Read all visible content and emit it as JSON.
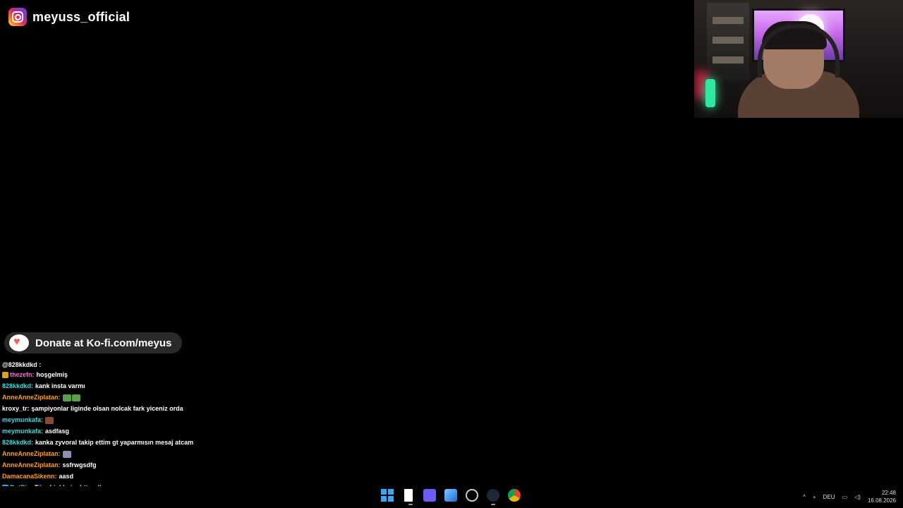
{
  "instagram": {
    "handle": "meyuss_official"
  },
  "donate": {
    "text": "Donate at Ko-fi.com/meyus"
  },
  "chat": [
    {
      "user": "@828kkdkd :",
      "text": "",
      "color": "#ffffff",
      "partial": true
    },
    {
      "user": "thezefn:",
      "text": "hoşgelmiş",
      "color": "#ff6ad5",
      "badge": "#e0a020"
    },
    {
      "user": "828kkdkd:",
      "text": "kank insta varmı",
      "color": "#3ed8e0"
    },
    {
      "user": "AnneAnneZiplatan:",
      "text": "",
      "color": "#ff9f1c",
      "emotes": [
        "#5aa04a",
        "#5aa04a"
      ]
    },
    {
      "user": "kroxy_tr:",
      "text": "şampiyonlar liginde olsan nolcak fark yiceniz orda",
      "color": "#ffffff"
    },
    {
      "user": "meymunkafa:",
      "text": "",
      "color": "#3ed8e0",
      "emotes": [
        "#8a4a3a"
      ]
    },
    {
      "user": "meymunkafa:",
      "text": "asdfasg",
      "color": "#3ed8e0"
    },
    {
      "user": "828kkdkd:",
      "text": "kanka zyvoral takip ettim gt yaparmısın mesaj atcam",
      "color": "#3ed8e0",
      "wrap": true
    },
    {
      "user": "AnneAnneZiplatan:",
      "text": "",
      "color": "#ff9f1c",
      "emotes": [
        "#8a8fb0"
      ]
    },
    {
      "user": "AnneAnneZiplatan:",
      "text": "ssfrwgsdfg",
      "color": "#ff9f1c"
    },
    {
      "user": "DamacanaSikenn:",
      "text": "aasd",
      "color": "#ff9f1c"
    },
    {
      "user": "BotRix:",
      "text": "Tüm Linklerim https://meyus.org",
      "color": "#5af078",
      "badge": "#3aa6f5"
    }
  ],
  "taskbar": {
    "icons": [
      "windows-start-icon",
      "file-explorer-icon",
      "calendar-app-icon",
      "photos-app-icon",
      "clock-app-icon",
      "steam-icon",
      "chrome-icon"
    ],
    "language": "DEU",
    "time": "22:48",
    "date": "16.08.2026"
  }
}
